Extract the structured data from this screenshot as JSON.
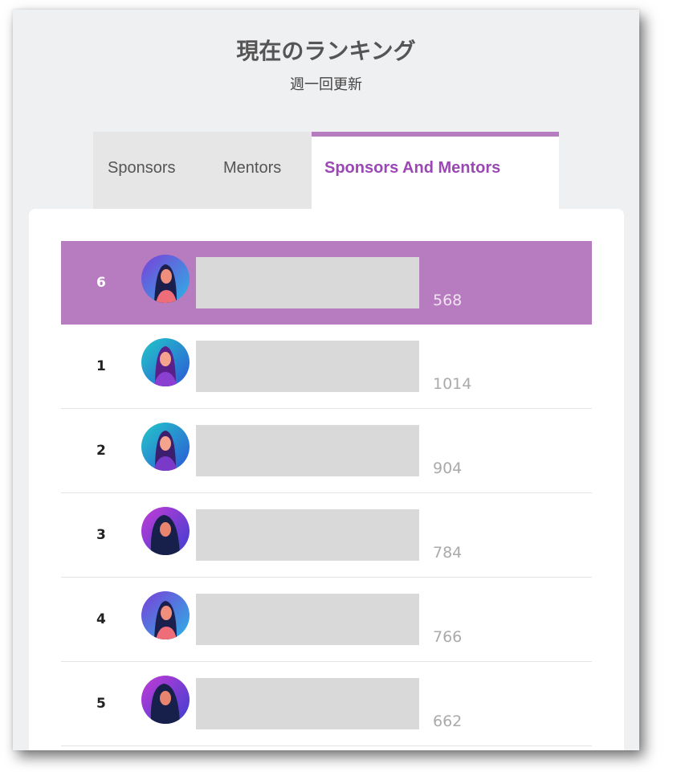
{
  "header": {
    "title": "現在のランキング",
    "subtitle": "週一回更新"
  },
  "tabs": [
    {
      "label": "Sponsors",
      "active": false
    },
    {
      "label": "Mentors",
      "active": false
    },
    {
      "label": "Sponsors And Mentors",
      "active": true
    }
  ],
  "leaderboard": [
    {
      "rank": "6",
      "score": "568",
      "avatar": "woman-avatar-icon",
      "current_user": true
    },
    {
      "rank": "1",
      "score": "1014",
      "avatar": "woman-avatar-icon"
    },
    {
      "rank": "2",
      "score": "904",
      "avatar": "woman-avatar-icon"
    },
    {
      "rank": "3",
      "score": "784",
      "avatar": "woman-avatar-icon"
    },
    {
      "rank": "4",
      "score": "766",
      "avatar": "woman-avatar-icon"
    },
    {
      "rank": "5",
      "score": "662",
      "avatar": "woman-avatar-icon"
    }
  ],
  "colors": {
    "accent": "#b77bbf",
    "active_tab_text": "#9b47b4",
    "panel_bg": "#eff0f2",
    "redaction": "#d9d9d9"
  }
}
